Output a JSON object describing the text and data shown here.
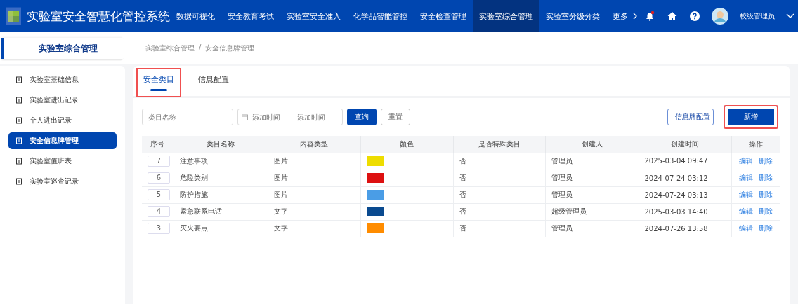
{
  "header": {
    "title": "实验室安全智慧化管控系统",
    "nav": [
      {
        "label": "数据可视化",
        "selected": false
      },
      {
        "label": "安全教育考试",
        "selected": false
      },
      {
        "label": "实验室安全准入",
        "selected": false
      },
      {
        "label": "化学品智能管控",
        "selected": false
      },
      {
        "label": "安全检查管理",
        "selected": false
      },
      {
        "label": "实验室综合管理",
        "selected": true
      },
      {
        "label": "实验室分级分类",
        "selected": false
      }
    ],
    "more": "更多",
    "notification": true,
    "user": "校级管理员"
  },
  "section_title": "实验室综合管理",
  "breadcrumb": [
    "实验室综合管理",
    "安全信息牌管理"
  ],
  "breadcrumb_separator": "/",
  "sidebar": {
    "items": [
      {
        "label": "实验室基础信息",
        "selected": false
      },
      {
        "label": "实验室进出记录",
        "selected": false
      },
      {
        "label": "个人进出记录",
        "selected": false
      },
      {
        "label": "安全信息牌管理",
        "selected": true
      },
      {
        "label": "实验室值班表",
        "selected": false
      },
      {
        "label": "实验室巡查记录",
        "selected": false
      }
    ]
  },
  "tabs": [
    {
      "label": "安全类目",
      "selected": true,
      "highlighted": true
    },
    {
      "label": "信息配置",
      "selected": false,
      "highlighted": false
    }
  ],
  "filters": {
    "name": {
      "placeholder": "类目名称"
    },
    "start": {
      "placeholder": "添加时间"
    },
    "separator": "-",
    "end": {
      "placeholder": "添加时间"
    },
    "search": "查询",
    "reset": "重置"
  },
  "actions": [
    {
      "label": "信息牌配置",
      "kind": "outline",
      "highlighted": false
    },
    {
      "label": "新增",
      "kind": "primary",
      "highlighted": true
    }
  ],
  "table": {
    "columns": [
      "序号",
      "类目名称",
      "内容类型",
      "颜色",
      "是否特殊类目",
      "创建人",
      "创建时间",
      "操作"
    ],
    "rows": [
      {
        "order": "7",
        "name": "注意事项",
        "type": "图片",
        "color": "#eedd00",
        "special": "否",
        "creator": "管理员",
        "time": "2025-03-04 09:47",
        "edit": "编辑",
        "delete": "删除"
      },
      {
        "order": "6",
        "name": "危险类别",
        "type": "图片",
        "color": "#dd1111",
        "special": "否",
        "creator": "管理员",
        "time": "2024-07-24 03:12",
        "edit": "编辑",
        "delete": "删除"
      },
      {
        "order": "5",
        "name": "防护措施",
        "type": "图片",
        "color": "#4a9de6",
        "special": "否",
        "creator": "管理员",
        "time": "2024-07-24 03:13",
        "edit": "编辑",
        "delete": "删除"
      },
      {
        "order": "4",
        "name": "紧急联系电话",
        "type": "文字",
        "color": "#0a4a8f",
        "special": "否",
        "creator": "超级管理员",
        "time": "2025-03-03 14:40",
        "edit": "编辑",
        "delete": "删除"
      },
      {
        "order": "3",
        "name": "灭火要点",
        "type": "文字",
        "color": "#ff8c00",
        "special": "否",
        "creator": "管理员",
        "time": "2024-07-26 13:58",
        "edit": "编辑",
        "delete": "删除"
      }
    ]
  }
}
